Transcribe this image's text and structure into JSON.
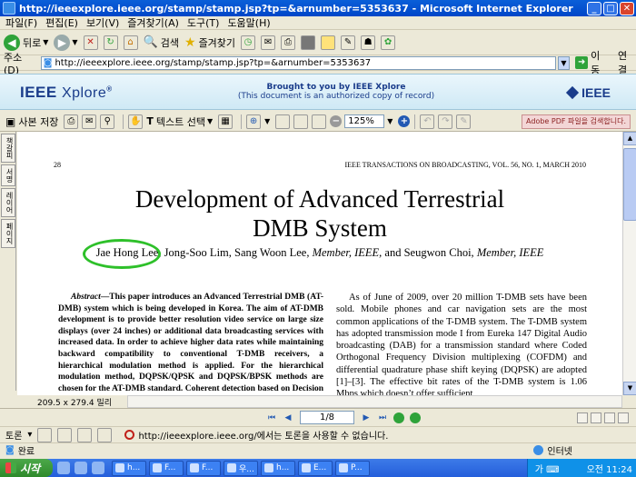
{
  "window": {
    "title": "http://ieeexplore.ieee.org/stamp/stamp.jsp?tp=&arnumber=5353637 - Microsoft Internet Explorer",
    "minimize": "_",
    "maximize": "□",
    "close": "✕"
  },
  "menu": [
    "파일(F)",
    "편집(E)",
    "보기(V)",
    "즐겨찾기(A)",
    "도구(T)",
    "도움말(H)"
  ],
  "toolbar": {
    "back": "뒤로",
    "search": "검색",
    "favorites": "즐겨찾기"
  },
  "address": {
    "label": "주소(D)",
    "url": "http://ieeexplore.ieee.org/stamp/stamp.jsp?tp=&arnumber=5353637",
    "go": "이동",
    "links": "연결"
  },
  "banner": {
    "logo": "IEEE",
    "logo2": "Xplore",
    "brought": "Brought to you by IEEE Xplore",
    "authorized": "(This document is an authorized copy of record)",
    "ieee": "IEEE"
  },
  "pdf_toolbar": {
    "save_copy": "사본 저장",
    "select_text": "텍스트 선택",
    "zoom": "125%",
    "adobe": "Adobe PDF 파일을 검색합니다."
  },
  "side_tabs": [
    "책갈피",
    "서명",
    "레이어",
    "페이지"
  ],
  "doc": {
    "page_number": "28",
    "journal": "IEEE TRANSACTIONS ON BROADCASTING, VOL. 56, NO. 1, MARCH 2010",
    "title_line1": "Development of Advanced Terrestrial",
    "title_line2": "DMB System",
    "author1": "Jae Hong Lee,",
    "authors_rest": " Jong-Soo Lim,  Sang Woon Lee, ",
    "aff1": "Member, IEEE,",
    "authors_and": " and  Seugwon Choi, ",
    "aff2": "Member, IEEE",
    "abstract_label": "Abstract",
    "abstract_text": "—This paper introduces an Advanced Terrestrial DMB (AT-DMB) system which is being developed in Korea. The aim of AT-DMB development is to provide better resolution video service on large size displays (over 24 inches) or additional data broadcasting services with increased data. In order to achieve higher data rates while maintaining backward compatibility to conventional T-DMB receivers, a hierarchical modulation method is applied. For the hierarchical modulation method, DQPSK/QPSK and DQPSK/BPSK methods are chosen for the AT-DMB standard. Coherent detection based on Decision Directed (DD) channel estima-",
    "intro_text": "As of June of 2009, over 20 million T-DMB sets have been sold. Mobile phones and car navigation sets are the most common applications of the T-DMB system. The T-DMB system has adopted transmission mode I from Eureka 147 Digital Audio broadcasting (DAB) for a transmission standard where Coded Orthogonal Frequency Division multiplexing (COFDM) and differential quadrature phase shift keying (DQPSK) are adopted [1]–[3]. The effective bit rates of the T-DMB system is 1.06 Mbps which doesn’t offer sufficient"
  },
  "page_size": "209.5 x 279.4 밀리",
  "navigation": {
    "page": "1/8"
  },
  "link_bar": {
    "label": "토론",
    "message": "http://ieeexplore.ieee.org/에서는 토론을 사용할 수 없습니다."
  },
  "status": {
    "text": "완료",
    "zone": "인터넷"
  },
  "taskbar": {
    "start": "시작",
    "tasks": [
      "h...",
      "F...",
      "F...",
      "우...",
      "h...",
      "E...",
      "P..."
    ],
    "ime": "가 ⌨",
    "clock": "오전 11:24"
  },
  "colors": {
    "highlight_circle": "#2ec02a",
    "ieee_blue": "#1a3c8b",
    "xp_blue": "#245edb"
  }
}
